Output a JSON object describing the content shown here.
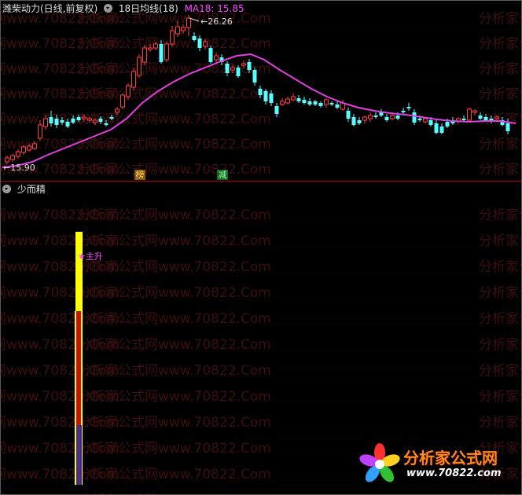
{
  "main_header": {
    "stock_title": "潍柴动力(日线,前复权)",
    "indicator_name": "18日均线(18)",
    "ma_value_label": "MA18: 15.85"
  },
  "sub_header": {
    "indicator_name": "少而精"
  },
  "annotations": {
    "high_price": "26.26",
    "low_price": "15.90",
    "signal_tag_1": "榜",
    "signal_tag_2": "减",
    "star_signal": "★主升"
  },
  "watermark": {
    "text": "分析家公式网www.70822.Com"
  },
  "logo": {
    "brand_text": "分析家公式网",
    "url_text": "www.70822.com"
  },
  "colors": {
    "background": "#000000",
    "up_candle": "#ff4040",
    "down_candle": "#54ffff",
    "ma_line": "#e040e0",
    "bar_yellow": "#ffff00",
    "bar_red": "#cc1010",
    "bar_purple": "#3030a0",
    "tag_orange": "#ffb040",
    "tag_green": "#40ff80"
  }
}
